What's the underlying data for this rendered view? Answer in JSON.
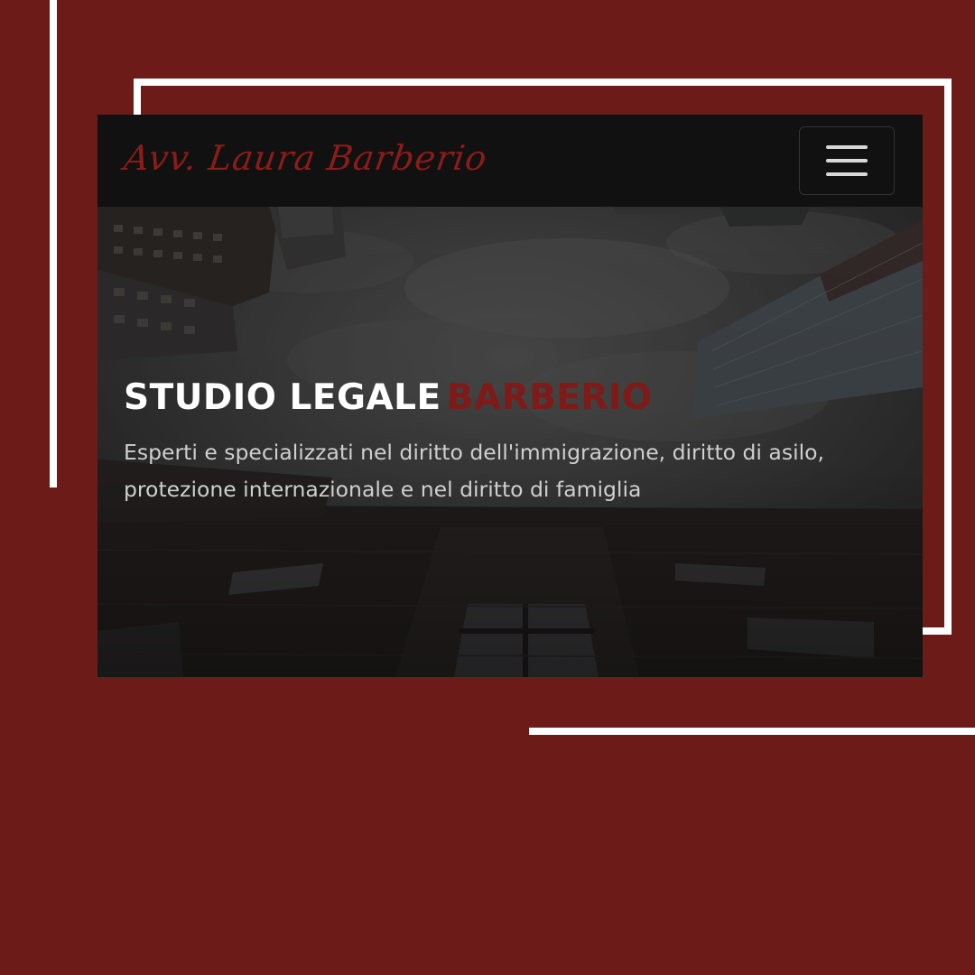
{
  "colors": {
    "background": "#6c1b18",
    "deco_white": "#ffffff",
    "navbar_bg": "#111111",
    "brand_red": "#8a1c19",
    "hero_title_white": "#ffffff",
    "hero_title_accent": "#7e1a17",
    "hero_subtitle": "#cfcfcf",
    "toggler_lines": "#d8d8d8"
  },
  "navbar": {
    "brand": "Avv. Laura Barberio",
    "toggler_icon": "hamburger-menu-icon"
  },
  "hero": {
    "title_main": "STUDIO LEGALE",
    "title_accent": "BARBERIO",
    "subtitle": "Esperti e specializzati nel diritto dell'immigrazione, diritto di asilo, protezione internazionale e nel diritto di famiglia"
  }
}
